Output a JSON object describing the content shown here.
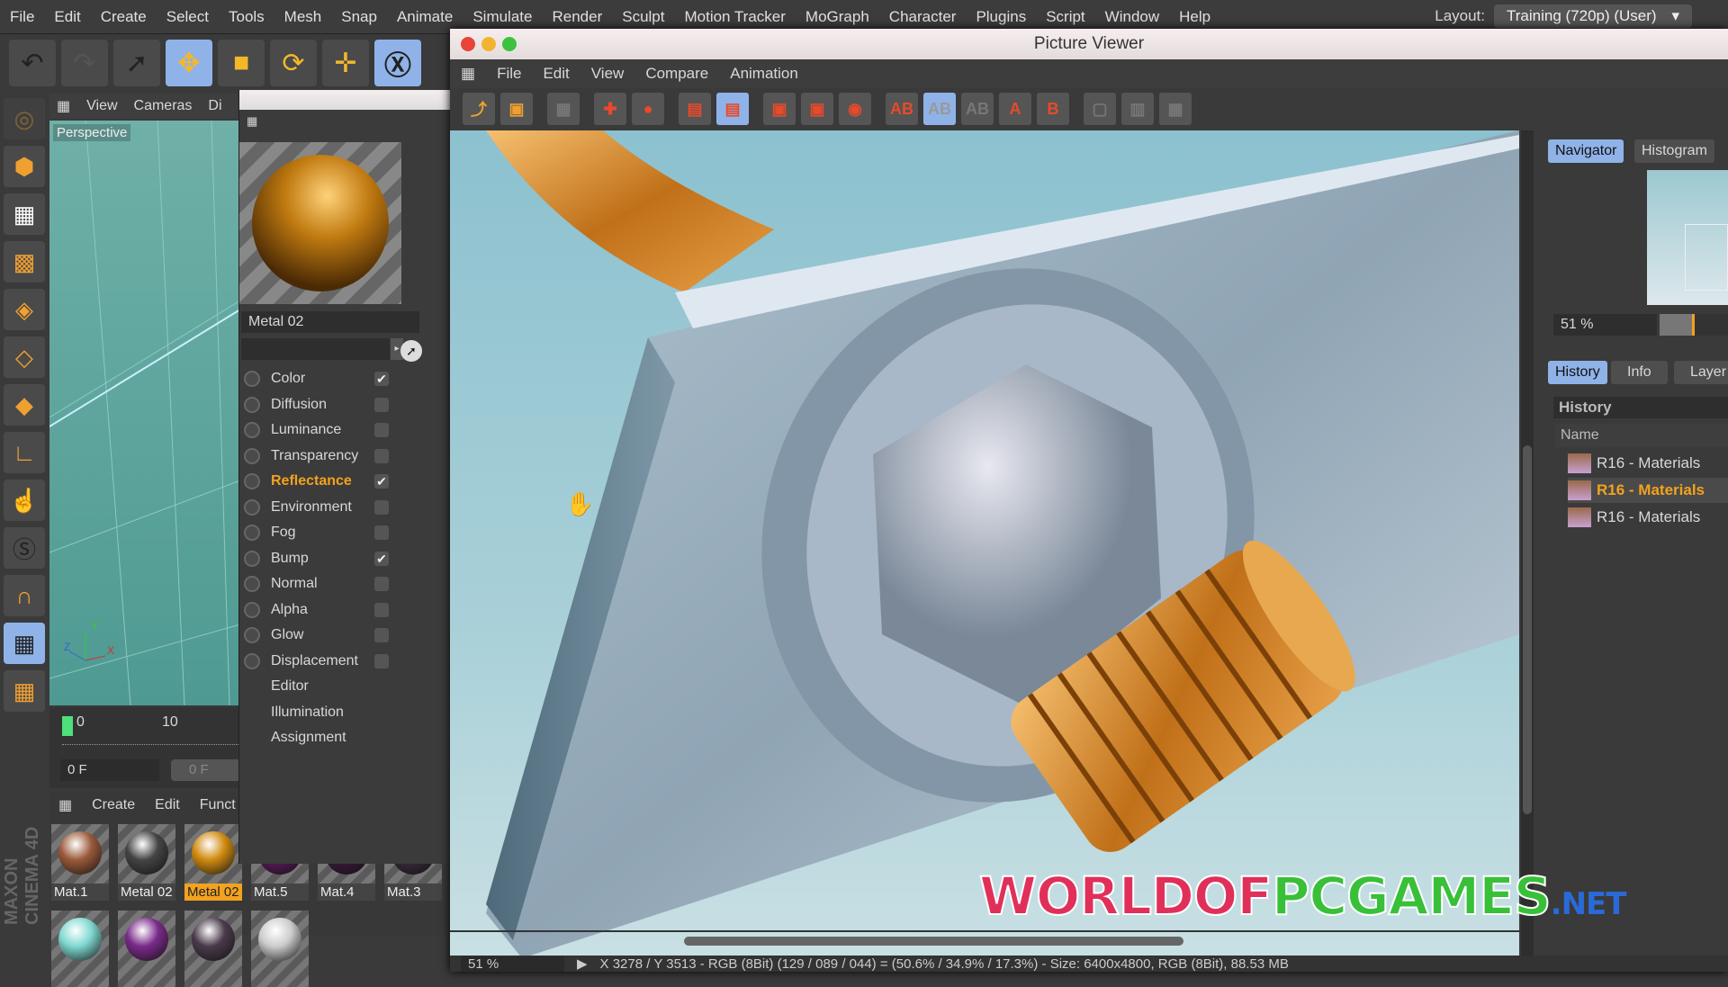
{
  "menubar": {
    "items": [
      "File",
      "Edit",
      "Create",
      "Select",
      "Tools",
      "Mesh",
      "Snap",
      "Animate",
      "Simulate",
      "Render",
      "Sculpt",
      "Motion Tracker",
      "MoGraph",
      "Character",
      "Plugins",
      "Script",
      "Window",
      "Help"
    ],
    "layout_label": "Layout:",
    "layout_value": "Training (720p) (User)"
  },
  "viewport": {
    "menu": [
      "View",
      "Cameras",
      "Di"
    ],
    "label": "Perspective",
    "axes": [
      "Y",
      "Z",
      "X"
    ]
  },
  "timeline": {
    "ticks": [
      "0",
      "10"
    ],
    "frame": "0 F",
    "frame2": "0 F"
  },
  "material_manager": {
    "menu": [
      "Create",
      "Edit",
      "Funct"
    ],
    "materials": [
      {
        "name": "Mat.1",
        "color": "#9a5a3a"
      },
      {
        "name": "Metal 02",
        "color": "#444"
      },
      {
        "name": "Metal 02",
        "color": "#d08a10",
        "selected": true
      },
      {
        "name": "Mat.5",
        "color": "#5a1a5a"
      },
      {
        "name": "Mat.4",
        "color": "#3a1a3a"
      },
      {
        "name": "Mat.3",
        "color": "#3a2a3a"
      },
      {
        "name": "",
        "color": "#7fd8d0"
      },
      {
        "name": "",
        "color": "#7a2a8a"
      },
      {
        "name": "",
        "color": "#4a3a4a"
      },
      {
        "name": "",
        "color": "#ccc"
      }
    ],
    "logo": "MAXON CINEMA 4D"
  },
  "material_editor": {
    "name": "Metal 02",
    "channels": [
      {
        "label": "Color",
        "checked": true
      },
      {
        "label": "Diffusion",
        "checked": false
      },
      {
        "label": "Luminance",
        "checked": false
      },
      {
        "label": "Transparency",
        "checked": false
      },
      {
        "label": "Reflectance",
        "checked": true,
        "active": true
      },
      {
        "label": "Environment",
        "checked": false
      },
      {
        "label": "Fog",
        "checked": false
      },
      {
        "label": "Bump",
        "checked": true
      },
      {
        "label": "Normal",
        "checked": false
      },
      {
        "label": "Alpha",
        "checked": false
      },
      {
        "label": "Glow",
        "checked": false
      },
      {
        "label": "Displacement",
        "checked": false
      }
    ],
    "extra": [
      "Editor",
      "Illumination",
      "Assignment"
    ],
    "check_glyph": "✔"
  },
  "picture_viewer": {
    "title": "Picture Viewer",
    "menu": [
      "File",
      "Edit",
      "View",
      "Compare",
      "Animation"
    ],
    "navigator": {
      "tabs": [
        "Navigator",
        "Histogram"
      ],
      "zoom": "51 %",
      "zoom_fraction": 0.51
    },
    "history": {
      "tabs": [
        "History",
        "Info",
        "Layer"
      ],
      "title": "History",
      "column": "Name",
      "items": [
        "R16 - Materials",
        "R16 - Materials",
        "R16 - Materials"
      ],
      "selected_index": 1
    },
    "status": {
      "zoom": "51 %",
      "info": "X 3278 / Y 3513 - RGB (8Bit) (129 / 089 / 044) = (50.6% / 34.9% / 17.3%) - Size: 6400x4800, RGB (8Bit), 88.53 MB"
    }
  },
  "watermark": {
    "part1": "WORLDOF",
    "part2": "PCGAMES",
    "part3": ".NET"
  },
  "colors": {
    "accent": "#f2a21f",
    "selection": "#8fb3e8"
  }
}
